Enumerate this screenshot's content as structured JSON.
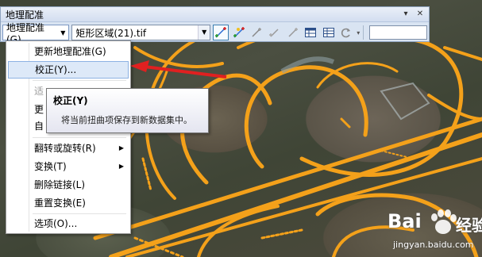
{
  "toolbar": {
    "title": "地理配准",
    "menu_button_label": "地理配准(G)",
    "layer_combo_value": "矩形区域(21).tif",
    "tools": [
      "add-control-points-icon",
      "auto-match-icon",
      "select-link-icon",
      "zoom-to-selected-icon",
      "rotate-icon",
      "view-table-icon",
      "view-link-table-icon",
      "redo-icon"
    ],
    "scale_value": ""
  },
  "menu": {
    "items": [
      {
        "label": "更新地理配准(G)",
        "disabled": false,
        "submenu": false
      },
      {
        "label": "校正(Y)...",
        "disabled": false,
        "submenu": false,
        "highlighted": true
      },
      {
        "label": "适",
        "disabled": true,
        "submenu": false
      },
      {
        "label": "更",
        "disabled": false,
        "submenu": false
      },
      {
        "label": "自",
        "disabled": false,
        "submenu": false
      },
      {
        "label": "翻转或旋转(R)",
        "disabled": false,
        "submenu": true
      },
      {
        "label": "变换(T)",
        "disabled": false,
        "submenu": true
      },
      {
        "label": "删除链接(L)",
        "disabled": false,
        "submenu": false
      },
      {
        "label": "重置变换(E)",
        "disabled": false,
        "submenu": false
      },
      {
        "label": "选项(O)...",
        "disabled": false,
        "submenu": false
      }
    ]
  },
  "tooltip": {
    "title": "校正(Y)",
    "description": "将当前扭曲项保存到新数据集中。"
  },
  "watermark": {
    "brand": "Bai",
    "brand_cn": "经验",
    "url": "jingyan.baidu.com"
  },
  "colors": {
    "overlay": "#f4a11a",
    "arrow": "#e02020",
    "menu_highlight": "#dde9f8"
  }
}
